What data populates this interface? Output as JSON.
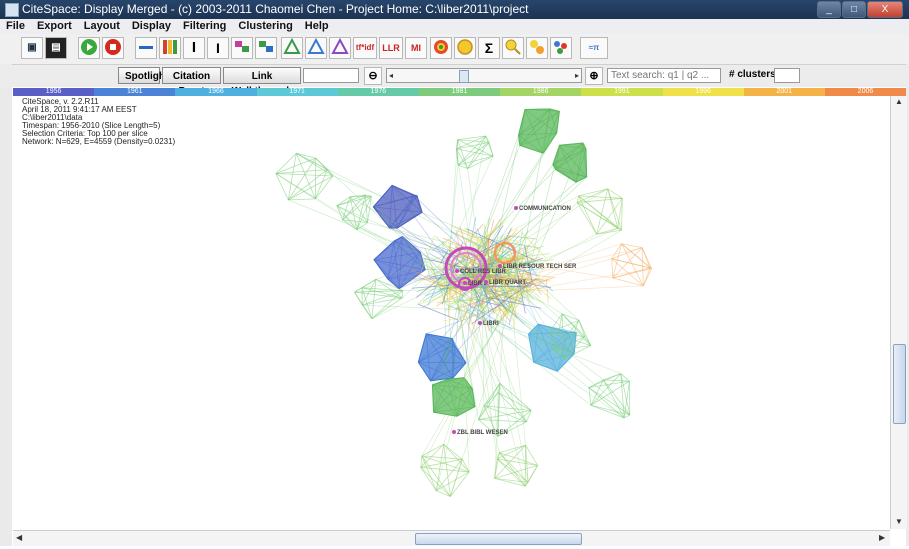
{
  "window": {
    "title": "CiteSpace: Display Merged - (c) 2003-2011 Chaomei Chen - Project Home: C:\\liber2011\\project"
  },
  "menu": [
    "File",
    "Export",
    "Layout",
    "Display",
    "Filtering",
    "Clustering",
    "Help"
  ],
  "toolbar_icons": [
    "save-icon",
    "clapper-icon",
    "play-icon",
    "stop-icon",
    "line-icon",
    "grid-icon",
    "bold-i-icon",
    "i-beam-icon",
    "cluster-pink-icon",
    "cluster-green-icon",
    "triangle-green-icon",
    "triangle-blue-icon",
    "triangle-purple-icon",
    "tfidf-icon",
    "llr-icon",
    "mi-icon",
    "ring-icon",
    "ring-yellow-icon",
    "sigma-icon",
    "search-yellow-icon",
    "chain-icon",
    "dots-icon",
    "spectrum-icon"
  ],
  "toolbar_text": {
    "tfidf": "tf*idf",
    "llr": "LLR",
    "mi": "MI",
    "sigma": "Σ"
  },
  "controls": {
    "spotlight": "Spotlight",
    "citation_burst": "Citation Burst",
    "link_walkthrough": "Link Walkthrough",
    "search_placeholder": "Text search: q1 | q2 ...",
    "clusters_label": "# clusters"
  },
  "timeline": {
    "years": [
      "1956",
      "1961",
      "1966",
      "1971",
      "1976",
      "1981",
      "1986",
      "1991",
      "1996",
      "2001",
      "2006"
    ],
    "colors": [
      "#5a5fc4",
      "#4d83d6",
      "#4fb0e0",
      "#5cc8d8",
      "#66c9a8",
      "#7ecb7e",
      "#a4d466",
      "#cde04c",
      "#f0e04a",
      "#f4b348",
      "#f08a4a"
    ]
  },
  "info": {
    "line1": "CiteSpace, v. 2.2.R11",
    "line2": "April 18, 2011 9:41:17 AM EEST",
    "line3": "C:\\liber2011\\data",
    "line4": "Timespan: 1956-2010 (Slice Length=5)",
    "line5": "Selection Criteria: Top 100 per slice",
    "line6": "Network: N=629, E=4559 (Density=0.0231)"
  },
  "node_labels": {
    "communication": "COMMUNICATION",
    "coll_res_libr": "COLL RES LIBR",
    "libr_resour_tech_ser": "LIBR RESOUR TECH SER",
    "libr_j": "LIBR J",
    "libr_quart": "LIBR QUART",
    "libri": "LIBRI",
    "zbl_bibl_wesen": "ZBL BIBL WESEN"
  }
}
